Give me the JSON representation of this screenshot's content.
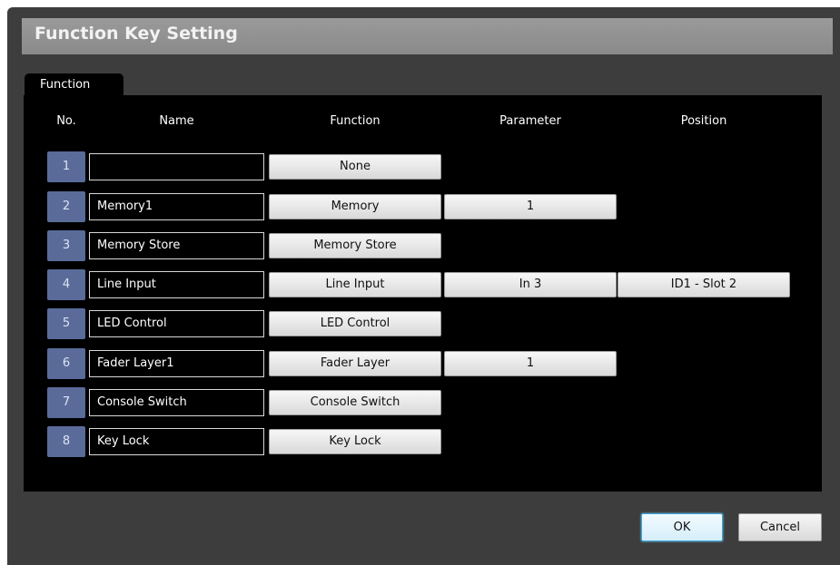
{
  "dialog": {
    "title": "Function Key Setting",
    "tab_label": "Function",
    "headers": {
      "no": "No.",
      "name": "Name",
      "function": "Function",
      "parameter": "Parameter",
      "position": "Position"
    },
    "rows": [
      {
        "no": "1",
        "name": "",
        "function": "None",
        "parameter": null,
        "position": null
      },
      {
        "no": "2",
        "name": "Memory1",
        "function": "Memory",
        "parameter": "1",
        "position": null
      },
      {
        "no": "3",
        "name": "Memory Store",
        "function": "Memory Store",
        "parameter": null,
        "position": null
      },
      {
        "no": "4",
        "name": "Line Input",
        "function": "Line Input",
        "parameter": "In 3",
        "position": "ID1 - Slot 2"
      },
      {
        "no": "5",
        "name": "LED Control",
        "function": "LED Control",
        "parameter": null,
        "position": null
      },
      {
        "no": "6",
        "name": "Fader Layer1",
        "function": "Fader Layer",
        "parameter": "1",
        "position": null
      },
      {
        "no": "7",
        "name": "Console Switch",
        "function": "Console Switch",
        "parameter": null,
        "position": null
      },
      {
        "no": "8",
        "name": "Key Lock",
        "function": "Key Lock",
        "parameter": null,
        "position": null
      }
    ],
    "ok_label": "OK",
    "cancel_label": "Cancel"
  },
  "colors": {
    "number_button": "#5a6b9a",
    "ok_border": "#39a6dd",
    "panel_bg": "#000000",
    "dialog_bg": "#3d3d3d"
  }
}
